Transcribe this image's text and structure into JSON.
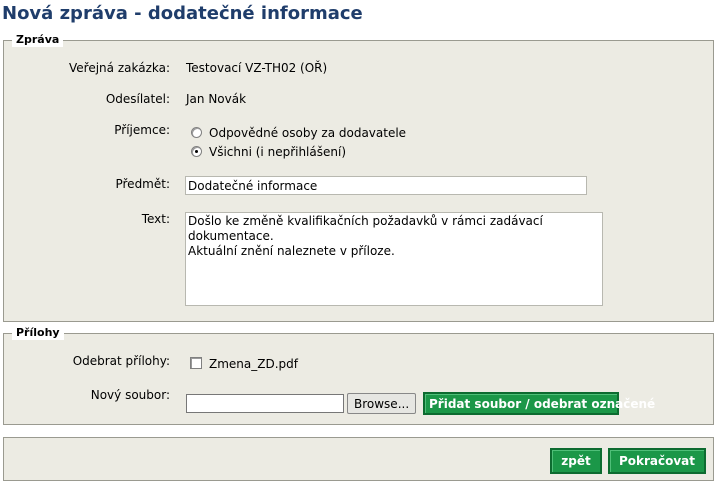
{
  "page": {
    "title": "Nová zpráva - dodatečné informace"
  },
  "message_section": {
    "legend": "Zpráva",
    "contract_label": "Veřejná zakázka:",
    "contract_value": "Testovací VZ-TH02 (OŘ)",
    "sender_label": "Odesílatel:",
    "sender_value": "Jan Novák",
    "recipient_label": "Příjemce:",
    "recipient_options": [
      {
        "label": "Odpovědné osoby za dodavatele",
        "checked": false
      },
      {
        "label": "Všichni (i nepřihlášení)",
        "checked": true
      }
    ],
    "subject_label": "Předmět:",
    "subject_value": "Dodatečné informace",
    "text_label": "Text:",
    "text_value": "Došlo ke změně kvalifikačních požadavků v rámci zadávací dokumentace.\nAktuální znění naleznete v příloze."
  },
  "attachments_section": {
    "legend": "Přílohy",
    "remove_label": "Odebrat přílohy:",
    "attachment_file": "Zmena_ZD.pdf",
    "attachment_checked": false,
    "new_file_label": "Nový soubor:",
    "browse_label": "Browse...",
    "add_remove_label": "Přidat soubor / odebrat označené"
  },
  "footer": {
    "back_label": "zpět",
    "continue_label": "Pokračovat"
  }
}
